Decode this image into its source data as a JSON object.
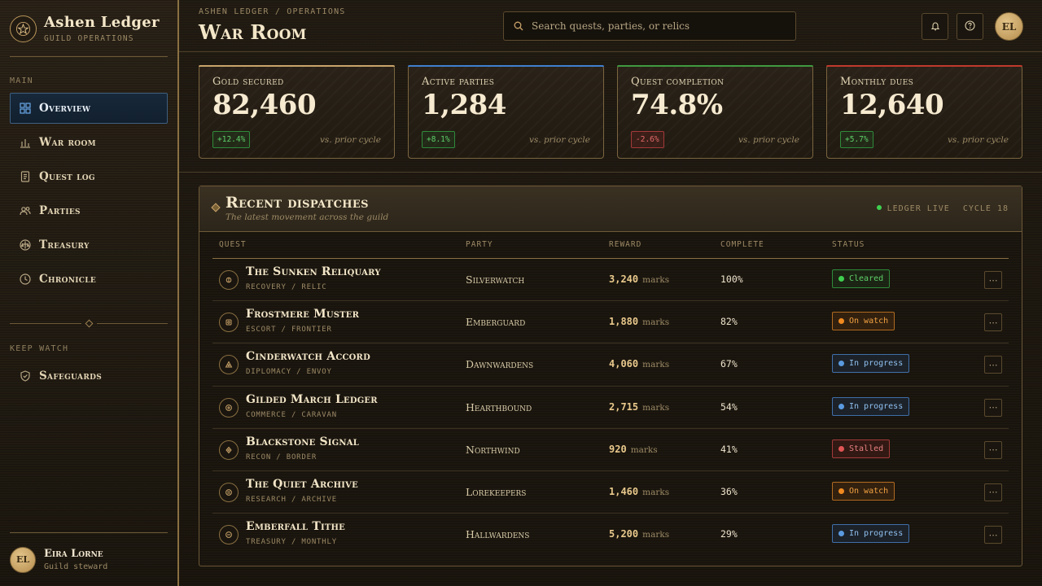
{
  "brand": {
    "title": "Ashen Ledger",
    "subtitle": "Guild operations"
  },
  "nav": {
    "section_main": "Main",
    "main_items": [
      {
        "label": "Overview",
        "icon": "grid-icon",
        "active": true
      },
      {
        "label": "War room",
        "icon": "bar-chart-icon",
        "active": false
      },
      {
        "label": "Quest log",
        "icon": "scroll-icon",
        "active": false
      },
      {
        "label": "Parties",
        "icon": "users-icon",
        "active": false
      },
      {
        "label": "Treasury",
        "icon": "coin-scale-icon",
        "active": false
      },
      {
        "label": "Chronicle",
        "icon": "clock-icon",
        "active": false
      }
    ],
    "section_watch": "Keep watch",
    "watch_items": [
      {
        "label": "Safeguards",
        "icon": "shield-check-icon",
        "active": false
      }
    ]
  },
  "user": {
    "initials": "EL",
    "name": "Eira Lorne",
    "role": "Guild steward"
  },
  "header": {
    "breadcrumb": "Ashen Ledger / Operations",
    "title": "War Room",
    "search_placeholder": "Search quests, parties, or relics",
    "avatar_initials": "EL"
  },
  "stats": [
    {
      "label": "Gold secured",
      "value": "82,460",
      "delta": "+12.4%",
      "direction": "up",
      "note": "vs. prior cycle",
      "accent": "#c9a46a"
    },
    {
      "label": "Active parties",
      "value": "1,284",
      "delta": "+8.1%",
      "direction": "up",
      "note": "vs. prior cycle",
      "accent": "#3f7fd0"
    },
    {
      "label": "Quest completion",
      "value": "74.8%",
      "delta": "-2.6%",
      "direction": "down",
      "note": "vs. prior cycle",
      "accent": "#3f9a3f"
    },
    {
      "label": "Monthly dues",
      "value": "12,640",
      "delta": "+5.7%",
      "direction": "up",
      "note": "vs. prior cycle",
      "accent": "#c0392b"
    }
  ],
  "dispatches": {
    "title": "Recent dispatches",
    "subtitle": "The latest movement across the guild",
    "live_label": "Ledger live",
    "cycle_label": "Cycle 18",
    "columns": {
      "quest": "Quest",
      "party": "Party",
      "reward": "Reward",
      "complete": "Complete",
      "status": "Status"
    },
    "rows": [
      {
        "name": "The Sunken Reliquary",
        "category": "Recovery / Relic",
        "party": "Silverwatch",
        "reward": "3,240",
        "unit": "marks",
        "complete": "100%",
        "status": "Cleared",
        "status_kind": "cleared",
        "icon": "relic-icon"
      },
      {
        "name": "Frostmere Muster",
        "category": "Escort / Frontier",
        "party": "Emberguard",
        "reward": "1,880",
        "unit": "marks",
        "complete": "82%",
        "status": "On watch",
        "status_kind": "watch",
        "icon": "target-icon"
      },
      {
        "name": "Cinderwatch Accord",
        "category": "Diplomacy / Envoy",
        "party": "Dawnwardens",
        "reward": "4,060",
        "unit": "marks",
        "complete": "67%",
        "status": "In progress",
        "status_kind": "progress",
        "icon": "triangle-seal-icon"
      },
      {
        "name": "Gilded March Ledger",
        "category": "Commerce / Caravan",
        "party": "Hearthbound",
        "reward": "2,715",
        "unit": "marks",
        "complete": "54%",
        "status": "In progress",
        "status_kind": "progress",
        "icon": "plus-seal-icon"
      },
      {
        "name": "Blackstone Signal",
        "category": "Recon / Border",
        "party": "Northwind",
        "reward": "920",
        "unit": "marks",
        "complete": "41%",
        "status": "Stalled",
        "status_kind": "stalled",
        "icon": "diamond-seal-icon"
      },
      {
        "name": "The Quiet Archive",
        "category": "Research / Archive",
        "party": "Lorekeepers",
        "reward": "1,460",
        "unit": "marks",
        "complete": "36%",
        "status": "On watch",
        "status_kind": "watch",
        "icon": "book-seal-icon"
      },
      {
        "name": "Emberfall Tithe",
        "category": "Treasury / Monthly",
        "party": "Hallwardens",
        "reward": "5,200",
        "unit": "marks",
        "complete": "29%",
        "status": "In progress",
        "status_kind": "progress",
        "icon": "coin-seal-icon"
      }
    ]
  },
  "status_colors": {
    "cleared": {
      "text": "#5fd06a",
      "border": "#2f8a3a",
      "bg": "rgba(40,110,48,0.18)",
      "dot": "#3fcf4f"
    },
    "watch": {
      "text": "#f0a040",
      "border": "#b06a20",
      "bg": "rgba(150,80,20,0.2)",
      "dot": "#f08a20"
    },
    "progress": {
      "text": "#8fc0f0",
      "border": "#3f6fa8",
      "bg": "rgba(40,80,140,0.22)",
      "dot": "#5a9ae0"
    },
    "stalled": {
      "text": "#e68080",
      "border": "#a33a3a",
      "bg": "rgba(140,40,40,0.22)",
      "dot": "#e05555"
    }
  }
}
